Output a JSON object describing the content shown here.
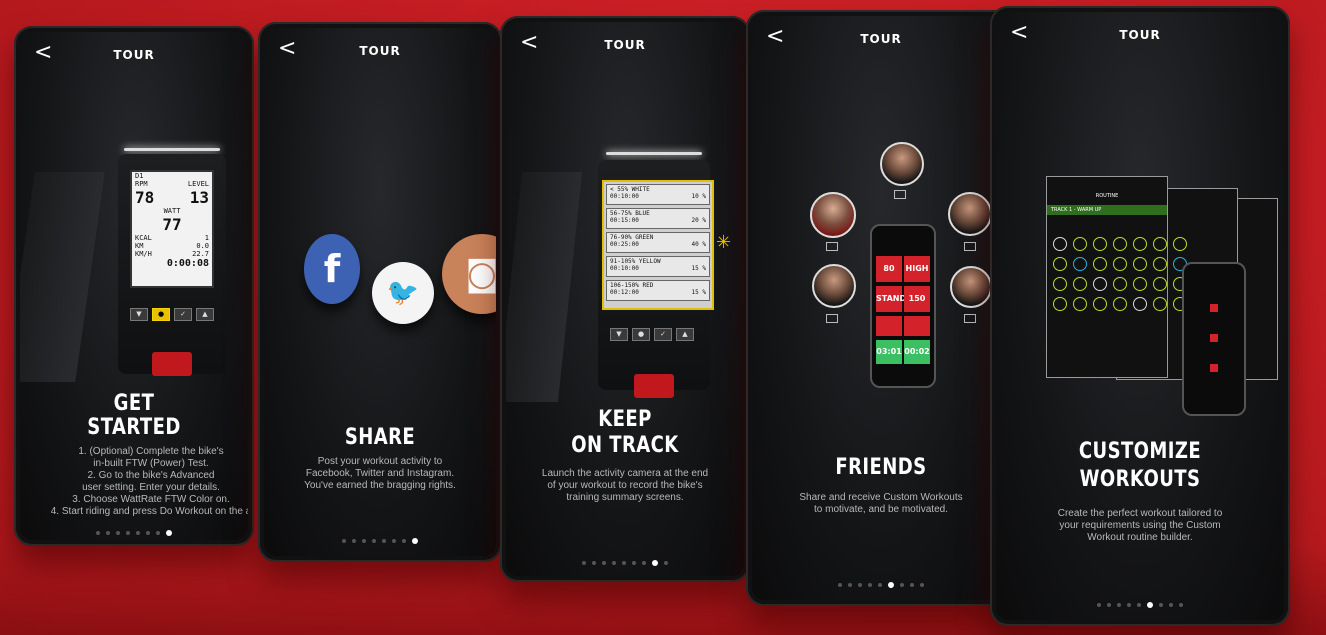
{
  "common": {
    "header_title": "TOUR",
    "back_label": "<"
  },
  "screens": [
    {
      "title_line1": "GET",
      "title_line2": "STARTED",
      "description": "1. (Optional) Complete the bike's\nin-built FTW (Power) Test.\n2. Go to the bike's Advanced\nuser setting. Enter your details.\n3. Choose WattRate FTW Color on.\n4. Start riding and press Do Workout on the a",
      "console": {
        "rpm_label": "RPM",
        "rpm": "78",
        "level_label": "LEVEL",
        "level": "13",
        "watt_label": "WATT",
        "watt": "77",
        "kcal_label": "KCAL",
        "kcal": "1",
        "km_label": "KM",
        "km": "0.0",
        "kmh_label": "KM/H",
        "kmh": "22.7",
        "time": "0:00:08",
        "d1": "D1"
      },
      "active_dot": 7,
      "dots": 8
    },
    {
      "title_line1": "SHARE",
      "description": "Post your workout activity to\nFacebook, Twitter and Instagram.\nYou've earned the bragging rights.",
      "social": {
        "facebook": "f",
        "twitter": "🐦",
        "instagram": "◙"
      },
      "active_dot": 7,
      "dots": 8
    },
    {
      "title_line1": "KEEP",
      "title_line2": "ON TRACK",
      "description": "Launch the activity camera at the end\nof your workout to record the bike's\ntraining summary screens.",
      "zones": [
        {
          "name": "< 55% WHITE",
          "time": "00:10:00",
          "pct": "10 %"
        },
        {
          "name": "56-75% BLUE",
          "time": "00:15:00",
          "pct": "20 %"
        },
        {
          "name": "76-90% GREEN",
          "time": "00:25:00",
          "pct": "40 %"
        },
        {
          "name": "91-105% YELLOW",
          "time": "00:10:00",
          "pct": "15 %"
        },
        {
          "name": "106-150% RED",
          "time": "00:12:00",
          "pct": "15 %"
        }
      ],
      "active_dot": 7,
      "dots": 9
    },
    {
      "title_line1": "FRIENDS",
      "description": "Share and receive Custom Workouts\nto motivate, and be motivated.",
      "tiles": [
        "80",
        "HIGH",
        "STAND",
        "150",
        "03:01",
        "00:02"
      ],
      "active_dot": 5,
      "dots": 9
    },
    {
      "title_line1": "CUSTOMIZE",
      "title_line2": "WORKOUTS",
      "description": "Create the perfect workout tailored to\nyour requirements using the Custom\nWorkout routine builder.",
      "sheet_title": "ROUTINE",
      "sheet_subtitle": "TRACK 1 - WARM UP",
      "active_dot": 5,
      "dots": 9
    }
  ]
}
